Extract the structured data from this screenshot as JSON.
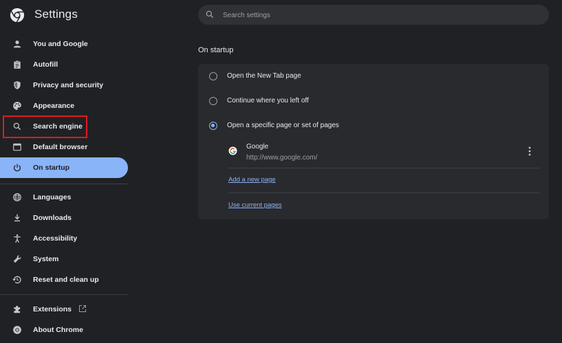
{
  "app": {
    "title": "Settings",
    "logo_icon": "chrome-logo-icon"
  },
  "search": {
    "placeholder": "Search settings",
    "value": ""
  },
  "sidebar": {
    "items": [
      {
        "label": "You and Google",
        "icon": "person-icon"
      },
      {
        "label": "Autofill",
        "icon": "clipboard-icon"
      },
      {
        "label": "Privacy and security",
        "icon": "shield-icon"
      },
      {
        "label": "Appearance",
        "icon": "palette-icon"
      },
      {
        "label": "Search engine",
        "icon": "search-icon"
      },
      {
        "label": "Default browser",
        "icon": "browser-icon"
      },
      {
        "label": "On startup",
        "icon": "power-icon",
        "active": true
      },
      {
        "label": "Languages",
        "icon": "globe-icon"
      },
      {
        "label": "Downloads",
        "icon": "download-icon"
      },
      {
        "label": "Accessibility",
        "icon": "accessibility-icon"
      },
      {
        "label": "System",
        "icon": "wrench-icon"
      },
      {
        "label": "Reset and clean up",
        "icon": "history-icon"
      },
      {
        "label": "Extensions",
        "icon": "puzzle-icon"
      },
      {
        "label": "About Chrome",
        "icon": "chrome-logo-icon"
      }
    ]
  },
  "startup": {
    "section_title": "On startup",
    "options": [
      {
        "label": "Open the New Tab page",
        "checked": false
      },
      {
        "label": "Continue where you left off",
        "checked": false
      },
      {
        "label": "Open a specific page or set of pages",
        "checked": true
      }
    ],
    "pages": [
      {
        "name": "Google",
        "url": "http://www.google.com/"
      }
    ],
    "add_link": "Add a new page",
    "use_current_link": "Use current pages"
  },
  "colors": {
    "background": "#202124",
    "card": "#292a2d",
    "accent": "#8ab4f8",
    "highlight": "#e21b1b"
  }
}
